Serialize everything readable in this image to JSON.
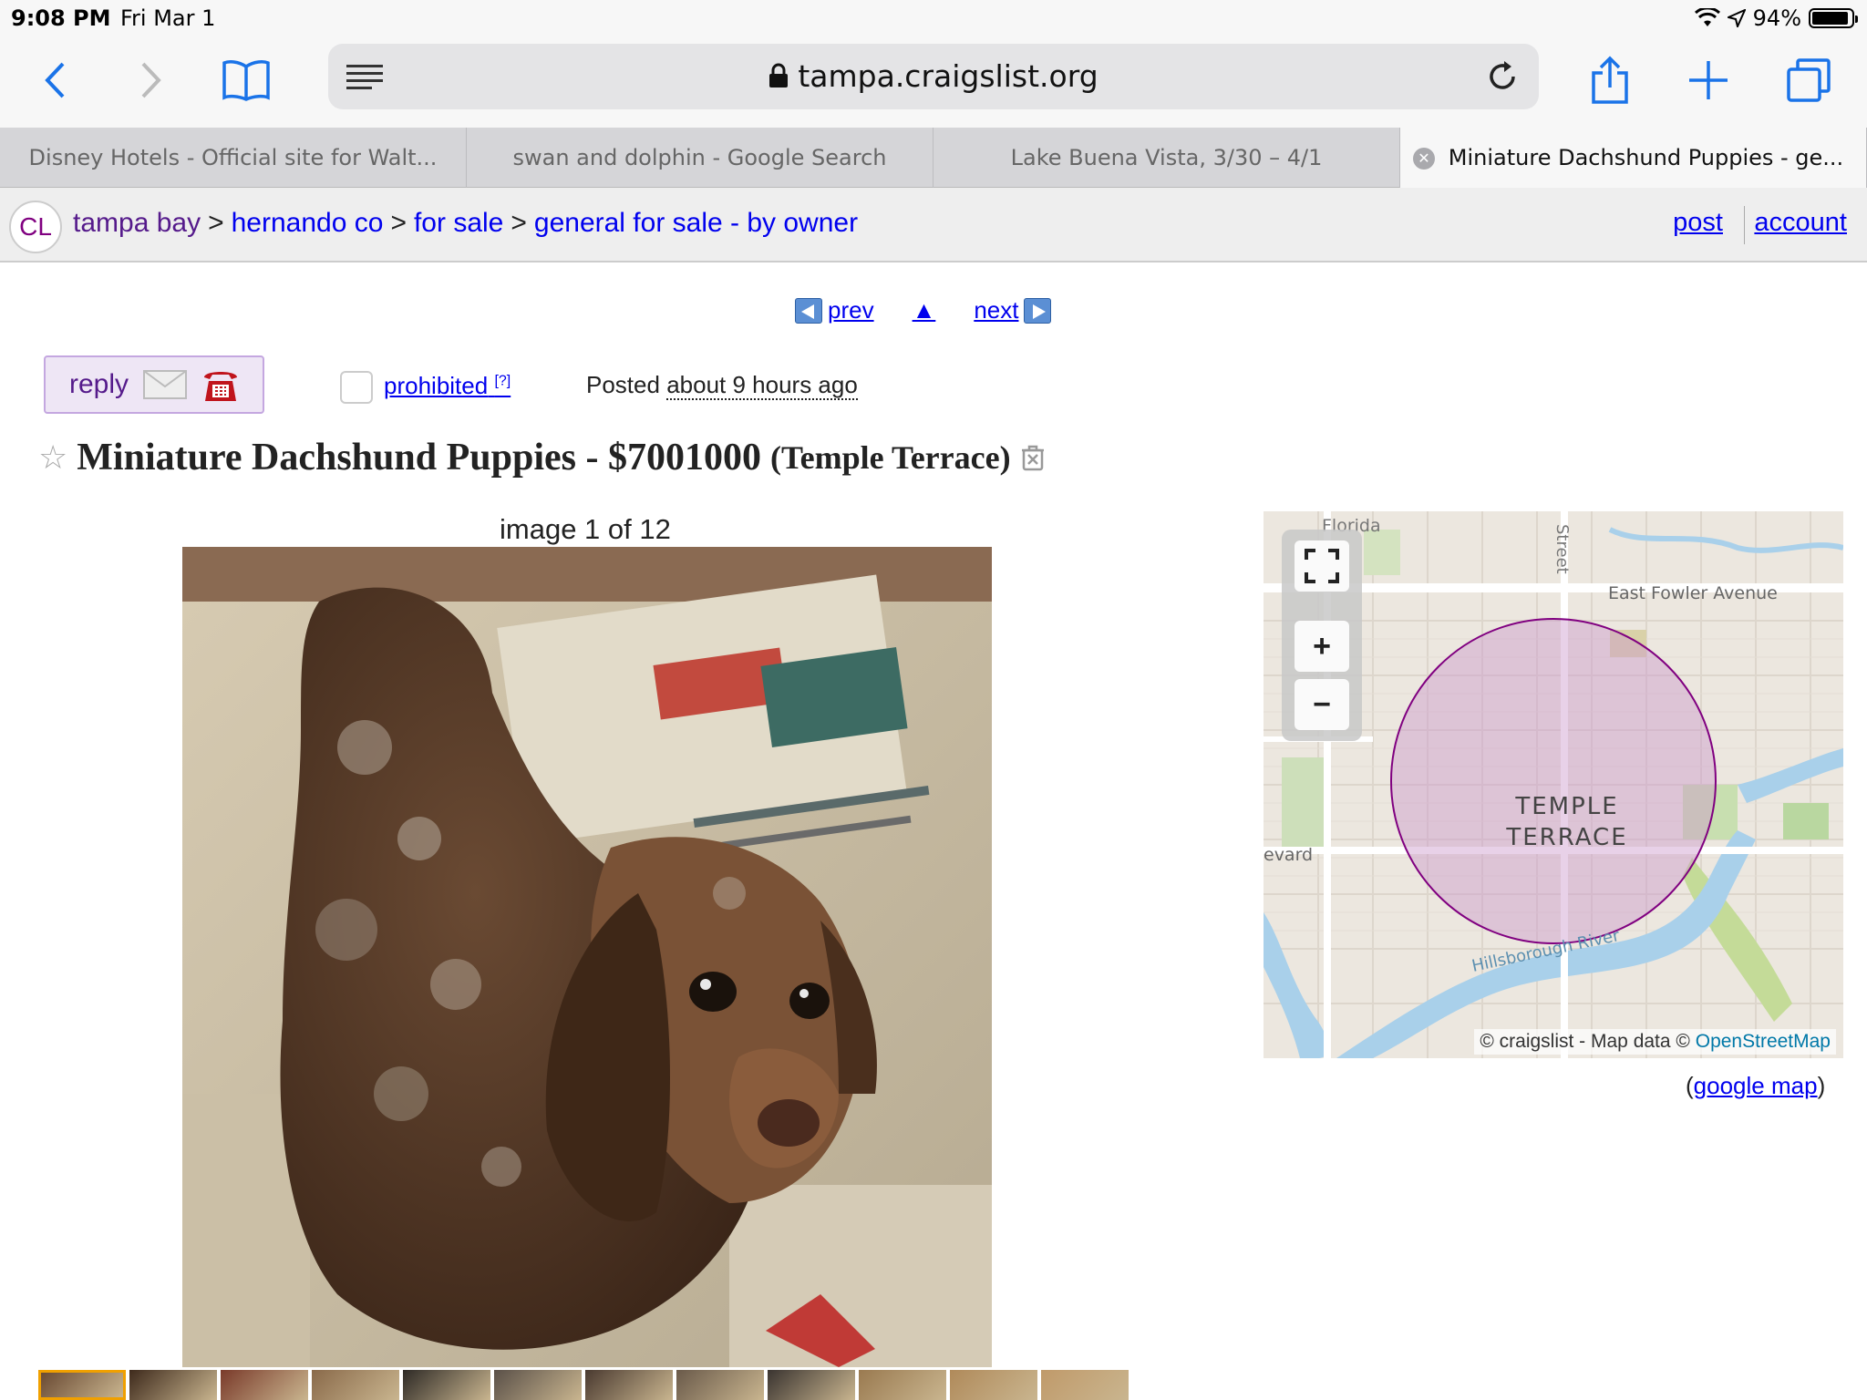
{
  "status_bar": {
    "time": "9:08 PM",
    "date": "Fri Mar 1",
    "battery_percent": "94%",
    "battery_level": 0.94
  },
  "browser": {
    "url": "tampa.craigslist.org",
    "icons": [
      "back-icon",
      "forward-icon",
      "bookmarks-icon",
      "reader-icon",
      "lock-icon",
      "reload-icon",
      "share-icon",
      "add-icon",
      "tabs-icon"
    ]
  },
  "tabs": [
    {
      "label": "Disney Hotels - Official site for Walt..."
    },
    {
      "label": "swan and dolphin - Google Search"
    },
    {
      "label": "Lake Buena Vista, 3/30 – 4/1"
    },
    {
      "label": "Miniature Dachshund Puppies - ge..."
    }
  ],
  "cl_header": {
    "logo": "CL",
    "breadcrumbs": [
      "tampa bay",
      "hernando co",
      "for sale",
      "general for sale - by owner"
    ],
    "separator": ">",
    "post": "post",
    "account": "account"
  },
  "nav": {
    "prev": "prev",
    "up": "▲",
    "next": "next"
  },
  "actions": {
    "reply": "reply",
    "prohibited": "prohibited",
    "prohibited_help": "[?]",
    "posted_label": "Posted",
    "posted_ago": "about 9 hours ago"
  },
  "listing": {
    "title": "Miniature Dachshund Puppies - $7001000",
    "location": "(Temple Terrace)",
    "image_counter": "image 1 of 12",
    "thumbnail_count": 12
  },
  "map": {
    "labels": {
      "florida": "Florida",
      "street": "Street",
      "fowler": "East Fowler Avenue",
      "evard": "evard",
      "temple": "TEMPLE",
      "terrace": "TERRACE",
      "river": "Hillsborough River"
    },
    "zoom_in": "+",
    "zoom_out": "−",
    "attribution_prefix": "© craigslist - Map data ©",
    "attribution_link": "OpenStreetMap",
    "google_open": "(",
    "google_map": "google map",
    "google_close": ")",
    "circle_color": "#800080"
  }
}
